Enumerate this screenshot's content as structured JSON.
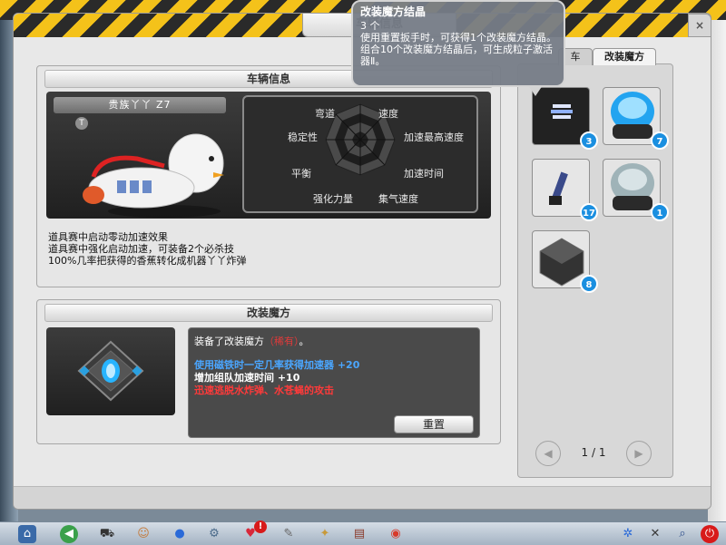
{
  "window": {
    "title": "车辆信息",
    "close_label": "×"
  },
  "vehicle_panel": {
    "header": "车辆信息",
    "vehicle_name": "贵族丫丫 Z7",
    "tier_badge": "T",
    "stats": {
      "labels": [
        "弯道",
        "速度",
        "加速最高速度",
        "加速时间",
        "集气速度",
        "强化力量",
        "平衡",
        "稳定性"
      ]
    },
    "description": [
      "道具赛中启动零动加速效果",
      "道具赛中强化启动加速，可装备2个必杀技",
      "100%几率把获得的香蕉转化成机器丫丫炸弹"
    ]
  },
  "cube_panel": {
    "header": "改装魔方",
    "equipped_prefix": "装备了改装魔方",
    "equipped_rarity": "（稀有）",
    "equipped_suffix": "。",
    "effect_blue": "使用磁铁时一定几率获得加速器 +20",
    "effect_black": "增加组队加速时间 +10",
    "effect_red": "迅速逃脱水炸弹、水苍蝇的攻击",
    "reset_button": "重置"
  },
  "inventory": {
    "tabs": [
      {
        "label": "车"
      },
      {
        "label": "改装魔方"
      }
    ],
    "items": [
      {
        "name": "crystal-item",
        "count": "3"
      },
      {
        "name": "blue-capsule-item",
        "count": "7"
      },
      {
        "name": "wrench-item",
        "count": "17"
      },
      {
        "name": "grey-capsule-item",
        "count": "1"
      },
      {
        "name": "dark-cube-item",
        "count": "8"
      }
    ],
    "pager": {
      "current": "1",
      "separator": "/",
      "total": "1",
      "prev": "◀",
      "next": "▶"
    }
  },
  "tooltip": {
    "title": "改装魔方结晶",
    "count": "3 个",
    "line1": "使用重置扳手时，可获得1个改装魔方结晶。",
    "line2": "组合10个改装魔方结晶后，可生成粒子激活器Ⅱ。"
  },
  "colors": {
    "rarity": "#e03a3a",
    "effect_blue": "#2f8ef0",
    "effect_red": "#e02a2a",
    "badge": "#1a8fe0"
  },
  "taskbar": {
    "icons": [
      "home-icon",
      "back-icon",
      "cart-icon",
      "character-icon",
      "potion-icon",
      "gear-icon",
      "heart-icon",
      "alert-icon",
      "wrench-icon",
      "puzzle-icon",
      "book-icon",
      "vehicle-icon",
      "network-icon",
      "tools-icon",
      "search-icon",
      "power-icon"
    ],
    "alert_badge": "!"
  }
}
